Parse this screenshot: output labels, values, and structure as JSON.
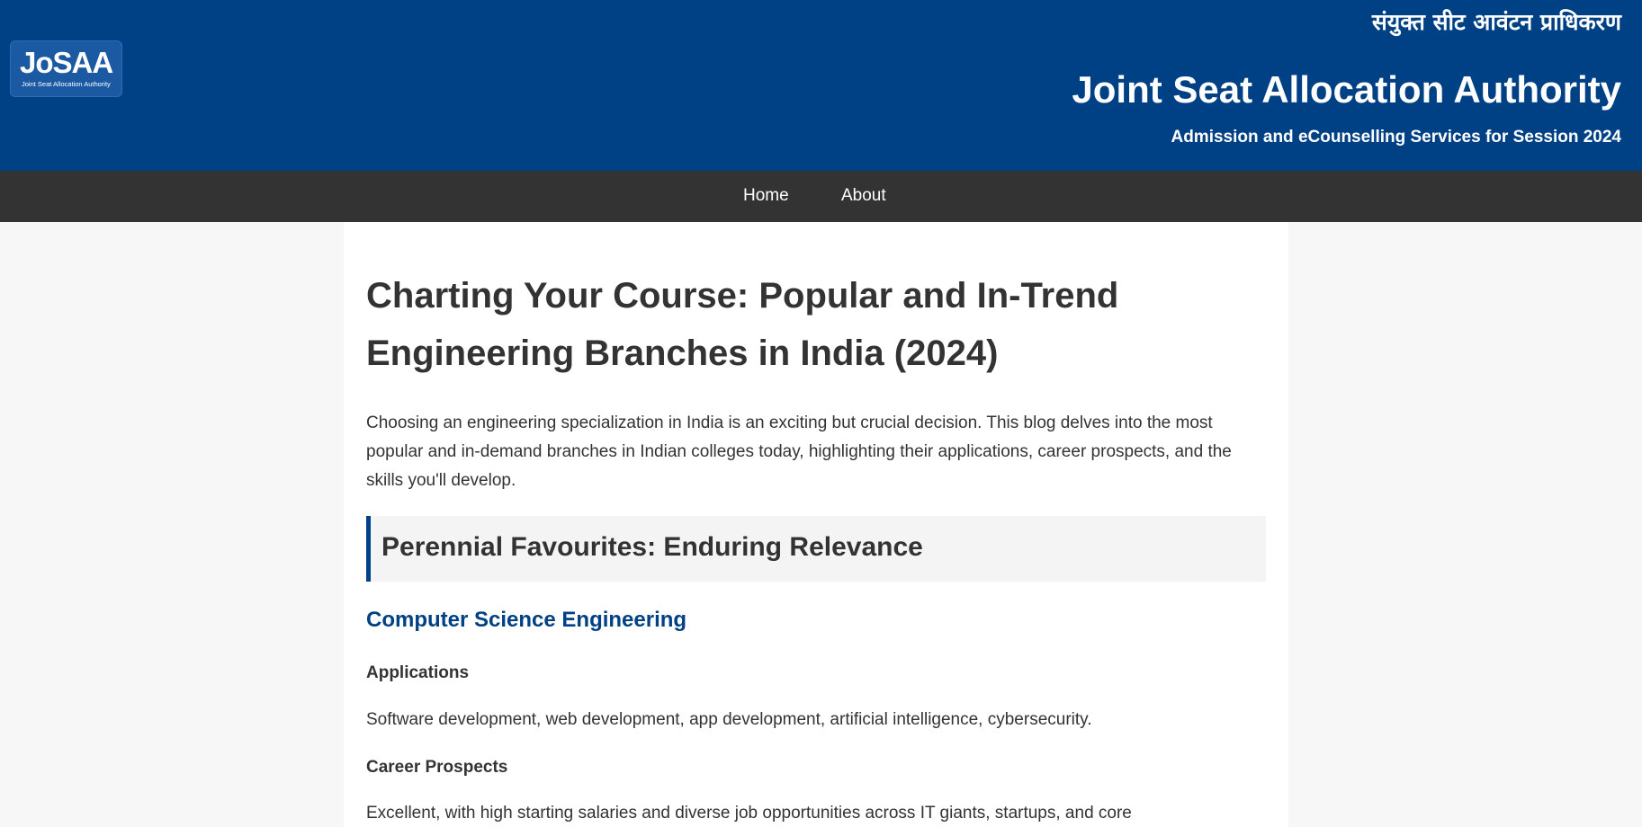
{
  "header": {
    "logo_text": "JoSAA",
    "logo_subtext": "Joint Seat Allocation Authority",
    "hindi_title": "संयुक्त सीट आवंटन प्राधिकरण",
    "title": "Joint Seat Allocation Authority",
    "subtitle": "Admission and eCounselling Services for Session 2024",
    "background_color": "#004085"
  },
  "nav": {
    "items": [
      {
        "label": "Home"
      },
      {
        "label": "About"
      }
    ],
    "background_color": "#333333"
  },
  "article": {
    "title": "Charting Your Course: Popular and In-Trend Engineering Branches in India (2024)",
    "intro": "Choosing an engineering specialization in India is an exciting but crucial decision. This blog delves into the most popular and in-demand branches in Indian colleges today, highlighting their applications, career prospects, and the skills you'll develop.",
    "sections": [
      {
        "heading": "Perennial Favourites: Enduring Relevance",
        "branches": [
          {
            "name": "Computer Science Engineering",
            "applications_heading": "Applications",
            "applications_text": "Software development, web development, app development, artificial intelligence, cybersecurity.",
            "career_heading": "Career Prospects",
            "career_text": "Excellent, with high starting salaries and diverse job opportunities across IT giants, startups, and core"
          }
        ]
      }
    ]
  },
  "colors": {
    "accent": "#004085",
    "page_background": "#f7f7f7",
    "content_background": "#ffffff",
    "section_background": "#f4f4f4"
  }
}
